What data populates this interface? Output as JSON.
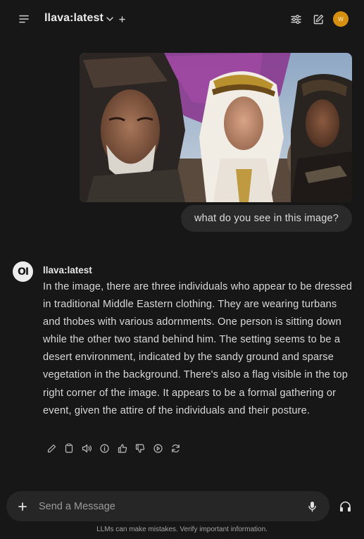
{
  "header": {
    "model_name": "llava:latest",
    "avatar_initial": "W",
    "avatar_color": "#d6900f"
  },
  "icons": {
    "menu": "menu-icon",
    "chevron": "chevron-down-icon",
    "add_model": "plus-icon",
    "controls": "sliders-icon",
    "new_chat": "edit-icon",
    "attach": "plus-icon",
    "mic": "microphone-icon",
    "call": "headphones-icon"
  },
  "user_message": {
    "text": "what do you see in this image?",
    "image_description": "still of three men in desert robes and headdresses with a purple flag behind"
  },
  "assistant_message": {
    "logo": "OI",
    "model_name": "llava:latest",
    "text": "In the image, there are three individuals who appear to be dressed in traditional Middle Eastern clothing. They are wearing turbans and thobes with various adornments. One person is sitting down while the other two stand behind him. The setting seems to be a desert environment, indicated by the sandy ground and sparse vegetation in the background. There's also a flag visible in the top right corner of the image. It appears to be a formal gathering or event, given the attire of the individuals and their posture.",
    "actions": [
      "edit",
      "copy",
      "read-aloud",
      "info",
      "good-response",
      "bad-response",
      "continue",
      "regenerate"
    ]
  },
  "composer": {
    "placeholder": "Send a Message",
    "value": ""
  },
  "footer": {
    "disclaimer": "LLMs can make mistakes. Verify important information."
  }
}
